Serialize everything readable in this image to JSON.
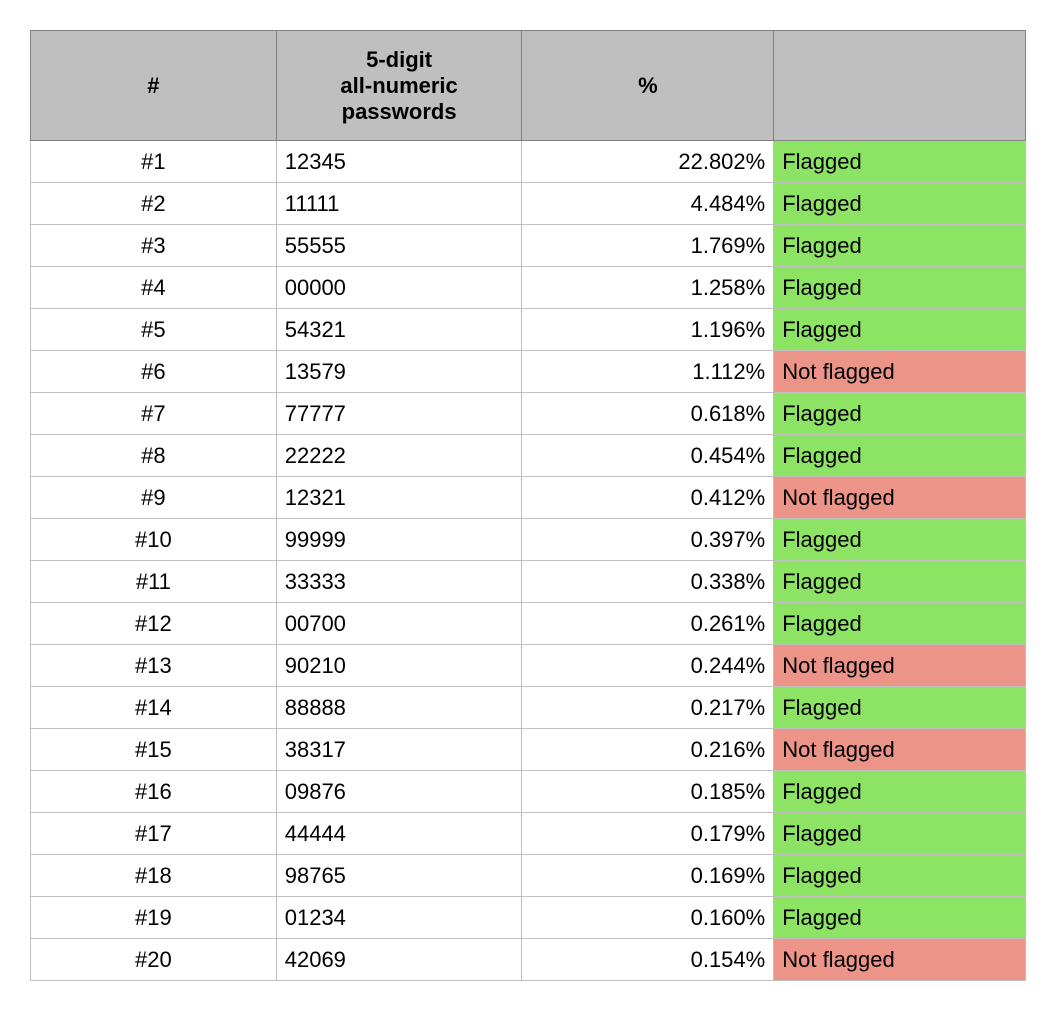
{
  "chart_data": {
    "type": "table",
    "columns": [
      "#",
      "5-digit all-numeric passwords",
      "%",
      ""
    ],
    "rows": [
      {
        "rank": "#1",
        "password": "12345",
        "pct": "22.802%",
        "status": "Flagged"
      },
      {
        "rank": "#2",
        "password": "11111",
        "pct": "4.484%",
        "status": "Flagged"
      },
      {
        "rank": "#3",
        "password": "55555",
        "pct": "1.769%",
        "status": "Flagged"
      },
      {
        "rank": "#4",
        "password": "00000",
        "pct": "1.258%",
        "status": "Flagged"
      },
      {
        "rank": "#5",
        "password": "54321",
        "pct": "1.196%",
        "status": "Flagged"
      },
      {
        "rank": "#6",
        "password": "13579",
        "pct": "1.112%",
        "status": "Not flagged"
      },
      {
        "rank": "#7",
        "password": "77777",
        "pct": "0.618%",
        "status": "Flagged"
      },
      {
        "rank": "#8",
        "password": "22222",
        "pct": "0.454%",
        "status": "Flagged"
      },
      {
        "rank": "#9",
        "password": "12321",
        "pct": "0.412%",
        "status": "Not flagged"
      },
      {
        "rank": "#10",
        "password": "99999",
        "pct": "0.397%",
        "status": "Flagged"
      },
      {
        "rank": "#11",
        "password": "33333",
        "pct": "0.338%",
        "status": "Flagged"
      },
      {
        "rank": "#12",
        "password": "00700",
        "pct": "0.261%",
        "status": "Flagged"
      },
      {
        "rank": "#13",
        "password": "90210",
        "pct": "0.244%",
        "status": "Not flagged"
      },
      {
        "rank": "#14",
        "password": "88888",
        "pct": "0.217%",
        "status": "Flagged"
      },
      {
        "rank": "#15",
        "password": "38317",
        "pct": "0.216%",
        "status": "Not flagged"
      },
      {
        "rank": "#16",
        "password": "09876",
        "pct": "0.185%",
        "status": "Flagged"
      },
      {
        "rank": "#17",
        "password": "44444",
        "pct": "0.179%",
        "status": "Flagged"
      },
      {
        "rank": "#18",
        "password": "98765",
        "pct": "0.169%",
        "status": "Flagged"
      },
      {
        "rank": "#19",
        "password": "01234",
        "pct": "0.160%",
        "status": "Flagged"
      },
      {
        "rank": "#20",
        "password": "42069",
        "pct": "0.154%",
        "status": "Not flagged"
      }
    ]
  },
  "headers": {
    "rank": "#",
    "password_line1": "5-digit",
    "password_line2": "all-numeric",
    "password_line3": "passwords",
    "pct": "%",
    "status": ""
  },
  "colors": {
    "header_bg": "#bfbfbf",
    "flagged_bg": "#8de364",
    "not_flagged_bg": "#ec9488"
  }
}
